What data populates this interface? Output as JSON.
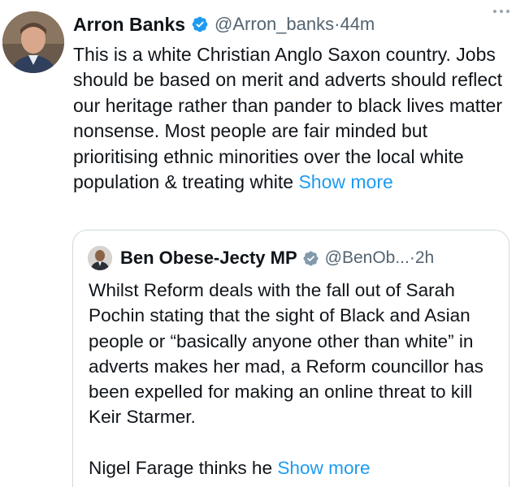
{
  "tweet": {
    "author_name": "Arron Banks",
    "author_handle": "@Arron_banks",
    "time_separator": " · ",
    "time": "44m",
    "text": "This is a white Christian Anglo Saxon country. Jobs should be based on merit and adverts should reflect our heritage rather than pander to black lives matter nonsense. Most people are fair minded but prioritising ethnic minorities over the local white population & treating white ",
    "show_more": "Show more"
  },
  "quoted_tweet": {
    "author_name": "Ben Obese-Jecty MP",
    "author_handle": "@BenOb...",
    "time_separator": " · ",
    "time": "2h",
    "text": "Whilst Reform deals with the fall out of Sarah Pochin stating that the sight of Black and Asian people or “basically anyone other than white” in adverts makes her mad, a Reform councillor has been expelled for making an online threat to kill Keir Starmer.\n\nNigel Farage thinks he ",
    "show_more": "Show more"
  },
  "colors": {
    "link": "#1d9bf0",
    "verified": "#1d9bf0",
    "secondary_text": "#536471",
    "border": "#cfd9de"
  },
  "icons": {
    "verified": "verified-badge-icon",
    "more": "more-horizontal-icon"
  }
}
